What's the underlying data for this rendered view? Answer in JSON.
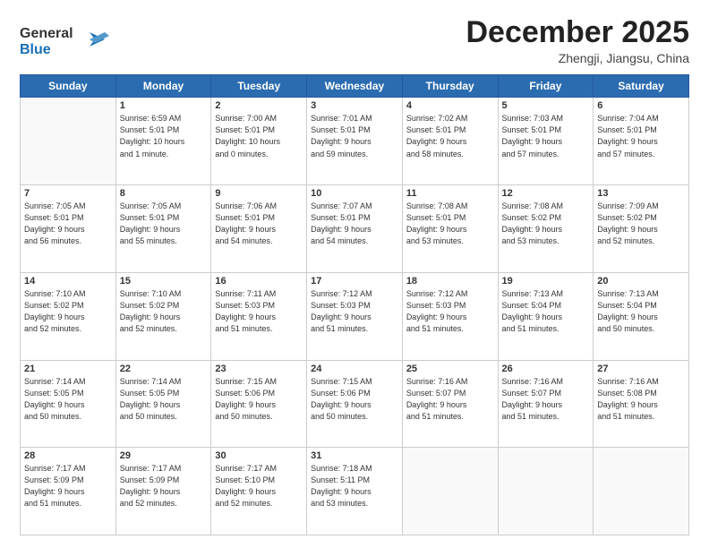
{
  "header": {
    "logo_line1": "General",
    "logo_line2": "Blue",
    "month": "December 2025",
    "location": "Zhengji, Jiangsu, China"
  },
  "weekdays": [
    "Sunday",
    "Monday",
    "Tuesday",
    "Wednesday",
    "Thursday",
    "Friday",
    "Saturday"
  ],
  "weeks": [
    [
      {
        "day": "",
        "info": ""
      },
      {
        "day": "1",
        "info": "Sunrise: 6:59 AM\nSunset: 5:01 PM\nDaylight: 10 hours\nand 1 minute."
      },
      {
        "day": "2",
        "info": "Sunrise: 7:00 AM\nSunset: 5:01 PM\nDaylight: 10 hours\nand 0 minutes."
      },
      {
        "day": "3",
        "info": "Sunrise: 7:01 AM\nSunset: 5:01 PM\nDaylight: 9 hours\nand 59 minutes."
      },
      {
        "day": "4",
        "info": "Sunrise: 7:02 AM\nSunset: 5:01 PM\nDaylight: 9 hours\nand 58 minutes."
      },
      {
        "day": "5",
        "info": "Sunrise: 7:03 AM\nSunset: 5:01 PM\nDaylight: 9 hours\nand 57 minutes."
      },
      {
        "day": "6",
        "info": "Sunrise: 7:04 AM\nSunset: 5:01 PM\nDaylight: 9 hours\nand 57 minutes."
      }
    ],
    [
      {
        "day": "7",
        "info": "Sunrise: 7:05 AM\nSunset: 5:01 PM\nDaylight: 9 hours\nand 56 minutes."
      },
      {
        "day": "8",
        "info": "Sunrise: 7:05 AM\nSunset: 5:01 PM\nDaylight: 9 hours\nand 55 minutes."
      },
      {
        "day": "9",
        "info": "Sunrise: 7:06 AM\nSunset: 5:01 PM\nDaylight: 9 hours\nand 54 minutes."
      },
      {
        "day": "10",
        "info": "Sunrise: 7:07 AM\nSunset: 5:01 PM\nDaylight: 9 hours\nand 54 minutes."
      },
      {
        "day": "11",
        "info": "Sunrise: 7:08 AM\nSunset: 5:01 PM\nDaylight: 9 hours\nand 53 minutes."
      },
      {
        "day": "12",
        "info": "Sunrise: 7:08 AM\nSunset: 5:02 PM\nDaylight: 9 hours\nand 53 minutes."
      },
      {
        "day": "13",
        "info": "Sunrise: 7:09 AM\nSunset: 5:02 PM\nDaylight: 9 hours\nand 52 minutes."
      }
    ],
    [
      {
        "day": "14",
        "info": "Sunrise: 7:10 AM\nSunset: 5:02 PM\nDaylight: 9 hours\nand 52 minutes."
      },
      {
        "day": "15",
        "info": "Sunrise: 7:10 AM\nSunset: 5:02 PM\nDaylight: 9 hours\nand 52 minutes."
      },
      {
        "day": "16",
        "info": "Sunrise: 7:11 AM\nSunset: 5:03 PM\nDaylight: 9 hours\nand 51 minutes."
      },
      {
        "day": "17",
        "info": "Sunrise: 7:12 AM\nSunset: 5:03 PM\nDaylight: 9 hours\nand 51 minutes."
      },
      {
        "day": "18",
        "info": "Sunrise: 7:12 AM\nSunset: 5:03 PM\nDaylight: 9 hours\nand 51 minutes."
      },
      {
        "day": "19",
        "info": "Sunrise: 7:13 AM\nSunset: 5:04 PM\nDaylight: 9 hours\nand 51 minutes."
      },
      {
        "day": "20",
        "info": "Sunrise: 7:13 AM\nSunset: 5:04 PM\nDaylight: 9 hours\nand 50 minutes."
      }
    ],
    [
      {
        "day": "21",
        "info": "Sunrise: 7:14 AM\nSunset: 5:05 PM\nDaylight: 9 hours\nand 50 minutes."
      },
      {
        "day": "22",
        "info": "Sunrise: 7:14 AM\nSunset: 5:05 PM\nDaylight: 9 hours\nand 50 minutes."
      },
      {
        "day": "23",
        "info": "Sunrise: 7:15 AM\nSunset: 5:06 PM\nDaylight: 9 hours\nand 50 minutes."
      },
      {
        "day": "24",
        "info": "Sunrise: 7:15 AM\nSunset: 5:06 PM\nDaylight: 9 hours\nand 50 minutes."
      },
      {
        "day": "25",
        "info": "Sunrise: 7:16 AM\nSunset: 5:07 PM\nDaylight: 9 hours\nand 51 minutes."
      },
      {
        "day": "26",
        "info": "Sunrise: 7:16 AM\nSunset: 5:07 PM\nDaylight: 9 hours\nand 51 minutes."
      },
      {
        "day": "27",
        "info": "Sunrise: 7:16 AM\nSunset: 5:08 PM\nDaylight: 9 hours\nand 51 minutes."
      }
    ],
    [
      {
        "day": "28",
        "info": "Sunrise: 7:17 AM\nSunset: 5:09 PM\nDaylight: 9 hours\nand 51 minutes."
      },
      {
        "day": "29",
        "info": "Sunrise: 7:17 AM\nSunset: 5:09 PM\nDaylight: 9 hours\nand 52 minutes."
      },
      {
        "day": "30",
        "info": "Sunrise: 7:17 AM\nSunset: 5:10 PM\nDaylight: 9 hours\nand 52 minutes."
      },
      {
        "day": "31",
        "info": "Sunrise: 7:18 AM\nSunset: 5:11 PM\nDaylight: 9 hours\nand 53 minutes."
      },
      {
        "day": "",
        "info": ""
      },
      {
        "day": "",
        "info": ""
      },
      {
        "day": "",
        "info": ""
      }
    ]
  ]
}
